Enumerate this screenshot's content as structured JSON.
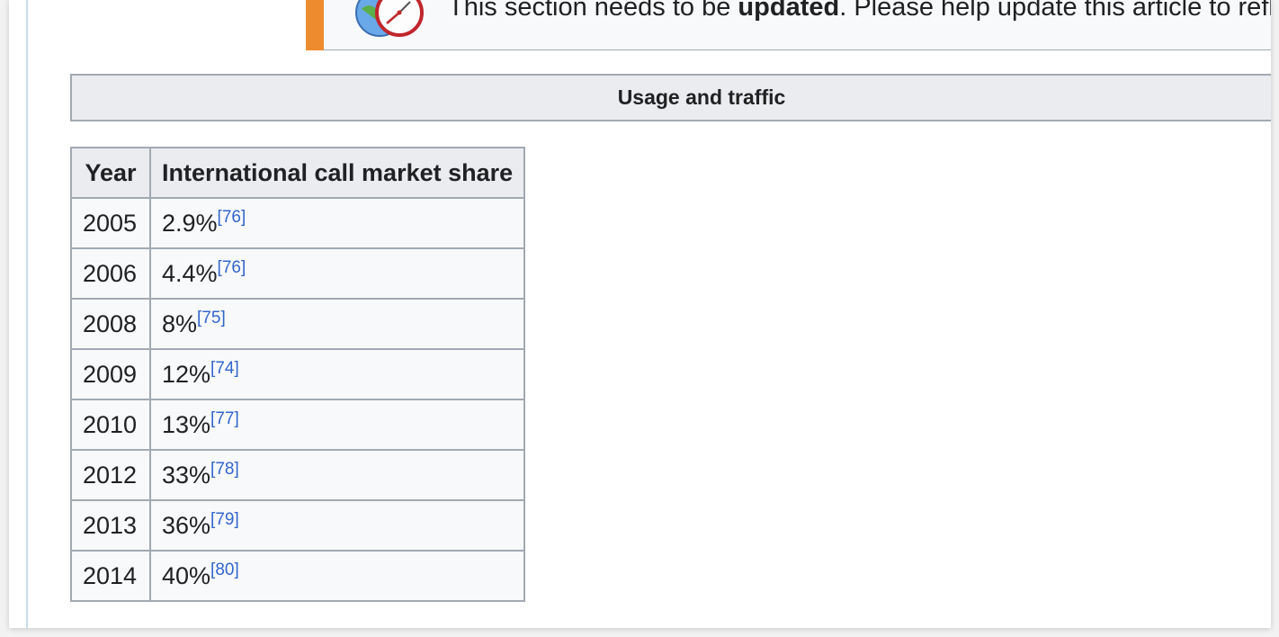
{
  "notice": {
    "text_before": "This section needs to be ",
    "text_bold": "updated",
    "text_after": ". Please help update this article to reflec",
    "icon": "globe-clock-icon",
    "bar_color": "#ee8b2e"
  },
  "navbox": {
    "title": "Usage and traffic"
  },
  "table": {
    "headers": [
      "Year",
      "International call market share"
    ],
    "rows": [
      {
        "year": "2005",
        "share": "2.9%",
        "ref": "[76]"
      },
      {
        "year": "2006",
        "share": "4.4%",
        "ref": "[76]"
      },
      {
        "year": "2008",
        "share": "8%",
        "ref": "[75]"
      },
      {
        "year": "2009",
        "share": "12%",
        "ref": "[74]"
      },
      {
        "year": "2010",
        "share": "13%",
        "ref": "[77]"
      },
      {
        "year": "2012",
        "share": "33%",
        "ref": "[78]"
      },
      {
        "year": "2013",
        "share": "36%",
        "ref": "[79]"
      },
      {
        "year": "2014",
        "share": "40%",
        "ref": "[80]"
      }
    ]
  },
  "colors": {
    "link": "#3366cc",
    "border": "#a2a9b1",
    "header_bg": "#eaecf0"
  }
}
